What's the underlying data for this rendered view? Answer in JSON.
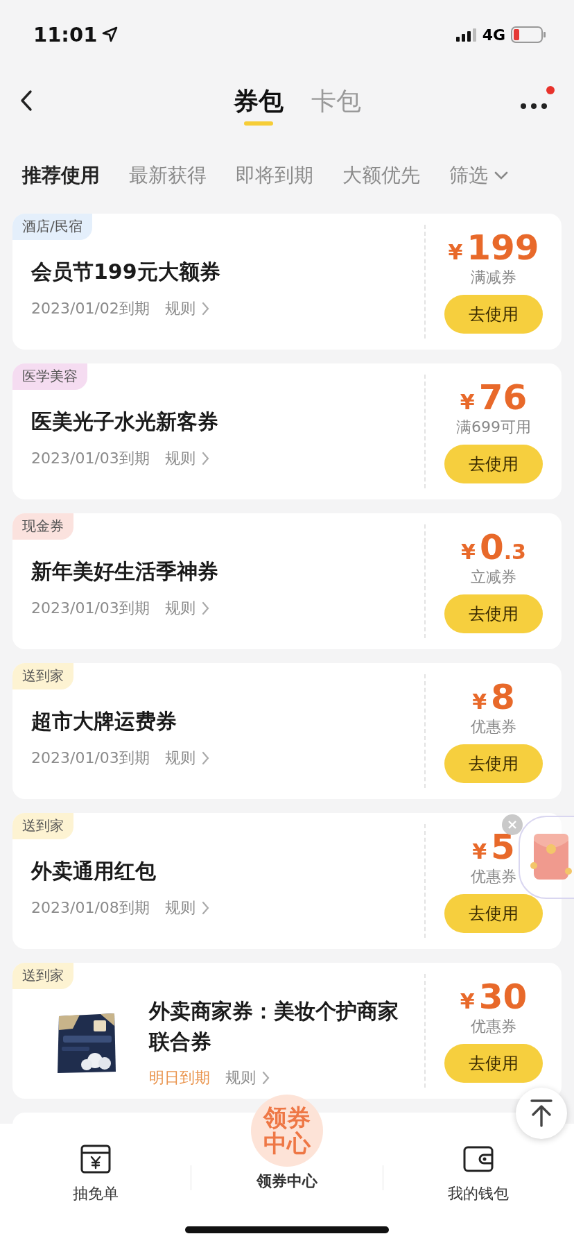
{
  "status_bar": {
    "time": "11:01",
    "network": "4G"
  },
  "header": {
    "tabs": [
      {
        "label": "券包",
        "selected": true
      },
      {
        "label": "卡包",
        "selected": false
      }
    ],
    "more_has_dot": true
  },
  "filters": [
    {
      "label": "推荐使用",
      "selected": true,
      "kind": "sort"
    },
    {
      "label": "最新获得",
      "selected": false,
      "kind": "sort"
    },
    {
      "label": "即将到期",
      "selected": false,
      "kind": "sort"
    },
    {
      "label": "大额优先",
      "selected": false,
      "kind": "sort"
    },
    {
      "label": "筛选",
      "selected": false,
      "kind": "dropdown"
    }
  ],
  "coupons": [
    {
      "tag": "酒店/民宿",
      "color": "#e4effb",
      "title": "会员节199元大额券",
      "expiry": "2023/01/02到期",
      "expiry_urgent": false,
      "rules": "规则",
      "currency": "¥",
      "amount": "199",
      "condition": "满减券",
      "button": "去使用"
    },
    {
      "tag": "医学美容",
      "color": "#f5dcf1",
      "title": "医美光子水光新客券",
      "expiry": "2023/01/03到期",
      "expiry_urgent": false,
      "rules": "规则",
      "currency": "¥",
      "amount": "76",
      "condition": "满699可用",
      "button": "去使用"
    },
    {
      "tag": "现金券",
      "color": "#fbe2de",
      "title": "新年美好生活季神券",
      "expiry": "2023/01/03到期",
      "expiry_urgent": false,
      "rules": "规则",
      "currency": "¥",
      "amount": "0",
      "decimal": ".3",
      "condition": "立减券",
      "button": "去使用"
    },
    {
      "tag": "送到家",
      "color": "#fdf3d2",
      "title": "超市大牌运费券",
      "expiry": "2023/01/03到期",
      "expiry_urgent": false,
      "rules": "规则",
      "currency": "¥",
      "amount": "8",
      "condition": "优惠券",
      "button": "去使用"
    },
    {
      "tag": "送到家",
      "color": "#fdf3d2",
      "title": "外卖通用红包",
      "expiry": "2023/01/08到期",
      "expiry_urgent": false,
      "rules": "规则",
      "currency": "¥",
      "amount": "5",
      "condition": "优惠券",
      "button": "去使用"
    },
    {
      "tag": "送到家",
      "color": "#fdf3d2",
      "kind": "picture",
      "title": "外卖商家券：美妆个护商家联合券",
      "expiry": "明日到期",
      "expiry_urgent": true,
      "rules": "规则",
      "currency": "¥",
      "amount": "30",
      "condition": "优惠券",
      "button": "去使用"
    }
  ],
  "bottom_nav": [
    {
      "label": "抽免单",
      "selected": false,
      "kind": "yen-box"
    },
    {
      "label": "领券中心",
      "selected": true,
      "kind": "badge",
      "badge_text": "领券中心"
    },
    {
      "label": "我的钱包",
      "selected": false,
      "kind": "wallet"
    }
  ]
}
